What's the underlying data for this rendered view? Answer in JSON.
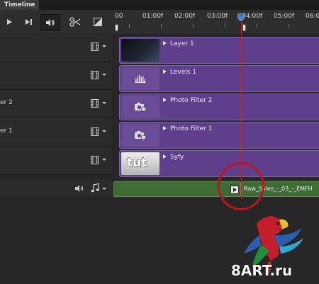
{
  "tabs": [
    "Timeline"
  ],
  "toolbar": {
    "buttons": [
      {
        "name": "play-icon",
        "state": "normal"
      },
      {
        "name": "step-forward-icon",
        "state": "normal"
      },
      {
        "name": "audio-icon",
        "state": "active"
      },
      {
        "name": "split-at-playhead-icon",
        "state": "normal"
      },
      {
        "name": "transition-icon",
        "state": "normal"
      }
    ]
  },
  "ruler": {
    "labels": [
      "00",
      "01:00f",
      "02:00f",
      "03:00f",
      "04:00f",
      "05:00f",
      "06:0"
    ]
  },
  "tracks": [
    {
      "name": "",
      "clip_label": "Layer 1",
      "thumbnail": "dark-gradient"
    },
    {
      "name": "",
      "clip_label": "Levels 1",
      "thumbnail": "levels-icon"
    },
    {
      "name": "er 2",
      "clip_label": "Photo Filter 2",
      "thumbnail": "camera-icon"
    },
    {
      "name": "er 1",
      "clip_label": "Photo Filter 1",
      "thumbnail": "camera-icon"
    },
    {
      "name": "",
      "clip_label": "Syfy",
      "thumbnail": "syfy-logo",
      "thumbnail_text": "tut"
    }
  ],
  "audio_track": {
    "clip_label": "Raw_Sales_-_03_-_EMFH"
  },
  "watermark": {
    "text": "8ART.ru"
  },
  "colors": {
    "clip_purple": "#5e3f8b",
    "audio_green": "#3f6b35",
    "playhead_red": "#c81f30",
    "highlight_red": "#c0141f"
  }
}
